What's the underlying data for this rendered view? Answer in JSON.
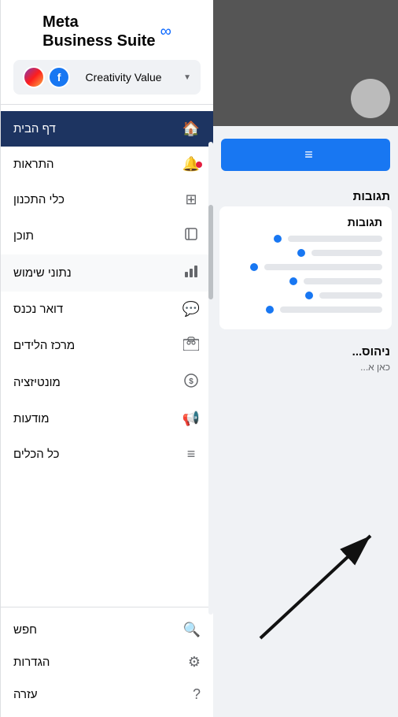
{
  "meta": {
    "logo_text": "∞ Meta\nBusiness Suite",
    "logo_line1": "Meta",
    "logo_line2": "Business Suite"
  },
  "account_selector": {
    "label": "Creativity Value",
    "dropdown_icon": "▼"
  },
  "nav": {
    "items": [
      {
        "id": "home",
        "label": "דף הבית",
        "icon": "🏠",
        "active": true,
        "has_dot": false
      },
      {
        "id": "alerts",
        "label": "התראות",
        "icon": "🔔",
        "active": false,
        "has_dot": true
      },
      {
        "id": "planner",
        "label": "כלי התכנון",
        "icon": "⊞",
        "active": false,
        "has_dot": false
      },
      {
        "id": "content",
        "label": "תוכן",
        "icon": "⬜",
        "active": false,
        "has_dot": false
      },
      {
        "id": "insights",
        "label": "נתוני שימוש",
        "icon": "📊",
        "active": false,
        "has_dot": false,
        "highlighted": true
      },
      {
        "id": "inbox",
        "label": "דואר נכנס",
        "icon": "💬",
        "active": false,
        "has_dot": false
      },
      {
        "id": "leads",
        "label": "מרכז הלידים",
        "icon": "👥",
        "active": false,
        "has_dot": false
      },
      {
        "id": "monetization",
        "label": "מונטיזציה",
        "icon": "$",
        "active": false,
        "has_dot": false
      },
      {
        "id": "ads",
        "label": "מודעות",
        "icon": "📢",
        "active": false,
        "has_dot": false
      },
      {
        "id": "all_tools",
        "label": "כל הכלים",
        "icon": "≡",
        "active": false,
        "has_dot": false
      }
    ],
    "bottom_items": [
      {
        "id": "search",
        "label": "חפש",
        "icon": "🔍"
      },
      {
        "id": "settings",
        "label": "הגדרות",
        "icon": "⚙"
      },
      {
        "id": "help",
        "label": "עזרה",
        "icon": "?"
      }
    ]
  },
  "left_panel": {
    "section1_title": "תגובות",
    "section2_title": "ניהוס...",
    "section2_sub": "כאן א..."
  },
  "arrow": {
    "label": "pointing to scrollbar"
  }
}
